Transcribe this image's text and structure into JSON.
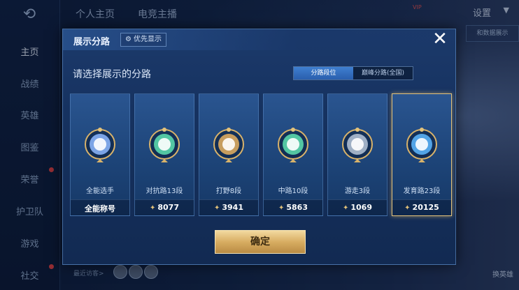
{
  "background": {
    "top_tabs": [
      "个人主页",
      "电竞主播"
    ],
    "settings_label": "设置",
    "vip_label": "VIP",
    "right_button_label": "和数据展示",
    "visitors_label": "最近访客>",
    "swap_hero_label": "换英雄"
  },
  "sidebar": {
    "items": [
      {
        "label": "主页",
        "active": true
      },
      {
        "label": "战绩"
      },
      {
        "label": "英雄"
      },
      {
        "label": "图鉴"
      },
      {
        "label": "荣誉"
      },
      {
        "label": "护卫队"
      },
      {
        "label": "游戏"
      },
      {
        "label": "社交"
      }
    ]
  },
  "modal": {
    "title": "展示分路",
    "priority_label": "优先显示",
    "subtitle": "请选择展示的分路",
    "toggle_options": [
      "分路段位",
      "巅峰分路(全国)"
    ],
    "selected_toggle": "分路段位",
    "confirm_label": "确定",
    "cards": [
      {
        "name": "全能选手",
        "score": "全能称号",
        "emblem": "allround-emblem-icon",
        "color": "#8fb8ff"
      },
      {
        "name": "对抗路13段",
        "score": "8077",
        "emblem": "clash-lane-emblem-icon",
        "color": "#5fe0b0"
      },
      {
        "name": "打野8段",
        "score": "3941",
        "emblem": "jungle-emblem-icon",
        "color": "#e8b060"
      },
      {
        "name": "中路10段",
        "score": "5863",
        "emblem": "mid-lane-emblem-icon",
        "color": "#5fe0b0"
      },
      {
        "name": "游走3段",
        "score": "1069",
        "emblem": "roam-emblem-icon",
        "color": "#b8c6d8"
      },
      {
        "name": "发育路23段",
        "score": "20125",
        "emblem": "farm-lane-emblem-icon",
        "color": "#5fb8ff",
        "selected": true
      }
    ]
  }
}
